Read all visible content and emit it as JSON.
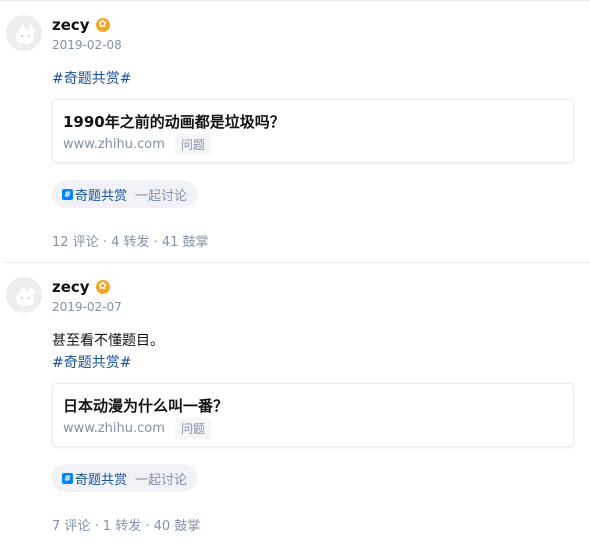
{
  "posts": [
    {
      "author": "zecy",
      "date": "2019-02-08",
      "text": "",
      "topic_link": "#奇题共赏#",
      "card": {
        "title": "1990年之前的动画都是垃圾吗？",
        "source": "www.zhihu.com",
        "tag": "问题"
      },
      "topic_pill": {
        "icon": "#",
        "topic": "奇题共赏",
        "action": "一起讨论"
      },
      "stats": "12 评论 · 4 转发 · 41 鼓掌"
    },
    {
      "author": "zecy",
      "date": "2019-02-07",
      "text": "甚至看不懂题目。",
      "topic_link": "#奇题共赏#",
      "card": {
        "title": "日本动漫为什么叫一番？",
        "source": "www.zhihu.com",
        "tag": "问题"
      },
      "topic_pill": {
        "icon": "#",
        "topic": "奇题共赏",
        "action": "一起讨论"
      },
      "stats": "7 评论 · 1 转发 · 40 鼓掌"
    }
  ],
  "colors": {
    "link": "#175199",
    "meta": "#8590a6",
    "badge": "#f5a623",
    "pill_bg": "#f0f2f7"
  },
  "icons": {
    "verified_badge": "verified-badge-icon",
    "avatar": "default-avatar-icon"
  }
}
